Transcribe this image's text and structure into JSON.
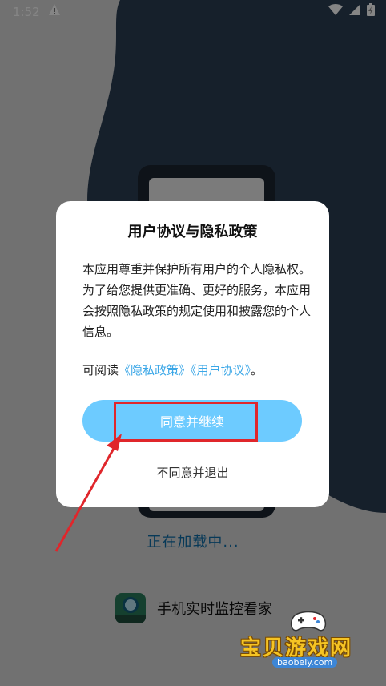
{
  "status_bar": {
    "time": "1:52",
    "warning_icon": "warning-icon",
    "wifi_icon": "wifi-icon",
    "signal_icon": "signal-icon",
    "battery_icon": "battery-charging-icon"
  },
  "background": {
    "loading_text": "正在加载中...",
    "app_name": "手机实时监控看家",
    "app_logo_icon": "camera-logo-icon"
  },
  "dialog": {
    "title": "用户协议与隐私政策",
    "body": "本应用尊重并保护所有用户的个人隐私权。为了给您提供更准确、更好的服务，本应用会按照隐私政策的规定使用和披露您的个人信息。",
    "read_prefix": "可阅读",
    "privacy_link": "《隐私政策》",
    "terms_link": "《用户协议》",
    "read_suffix": "。",
    "agree_label": "同意并继续",
    "disagree_label": "不同意并退出"
  },
  "watermark": {
    "title": "宝贝游戏网",
    "url": "baobeiy.com"
  },
  "colors": {
    "accent": "#6dcbff",
    "link": "#3ba7e7",
    "annotation": "#e0262b",
    "dark_blob": "#2b3e54"
  }
}
